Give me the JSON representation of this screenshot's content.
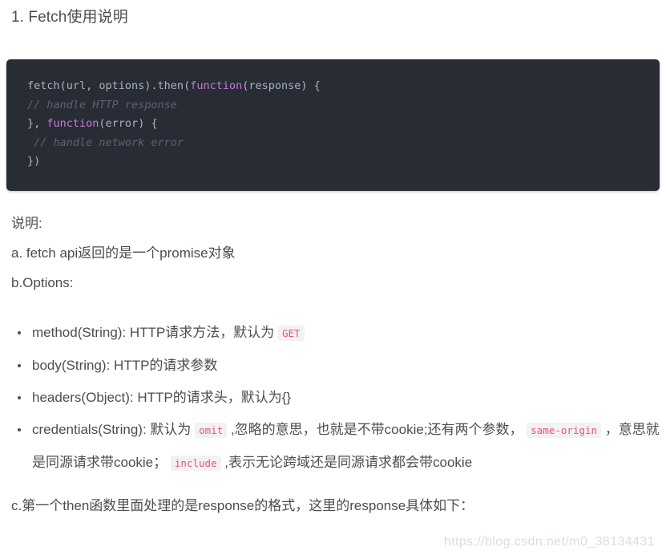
{
  "document": {
    "title": "1. Fetch使用说明",
    "background_color": "#ffffff",
    "text_color": "#4d4d4d"
  },
  "code_block": {
    "theme_background": "#282c34",
    "default_text_color": "#abb2bf",
    "keyword_color": "#c678dd",
    "comment_color": "#5c6370",
    "language": "javascript",
    "lines": [
      {
        "segments": [
          {
            "text": "fetch(url, options).then(",
            "type": "plain"
          },
          {
            "text": "function",
            "type": "keyword"
          },
          {
            "text": "(response) {",
            "type": "plain"
          }
        ]
      },
      {
        "segments": [
          {
            "text": "// handle HTTP response",
            "type": "comment"
          }
        ]
      },
      {
        "segments": [
          {
            "text": "}, ",
            "type": "plain"
          },
          {
            "text": "function",
            "type": "keyword"
          },
          {
            "text": "(error) {",
            "type": "plain"
          }
        ]
      },
      {
        "segments": [
          {
            "text": " // handle network error",
            "type": "comment"
          }
        ]
      },
      {
        "segments": [
          {
            "text": "})",
            "type": "plain"
          }
        ]
      }
    ]
  },
  "prose": {
    "note_label": "说明:",
    "item_a": "a. fetch api返回的是一个promise对象",
    "item_b": "b.Options:"
  },
  "options_list": {
    "items": [
      {
        "parts": [
          {
            "text": "method(String): HTTP请求方法，默认为 ",
            "type": "text"
          },
          {
            "text": "GET",
            "type": "code"
          }
        ]
      },
      {
        "parts": [
          {
            "text": "body(String): HTTP的请求参数",
            "type": "text"
          }
        ]
      },
      {
        "parts": [
          {
            "text": "headers(Object): HTTP的请求头，默认为{}",
            "type": "text"
          }
        ]
      },
      {
        "parts": [
          {
            "text": "credentials(String): 默认为 ",
            "type": "text"
          },
          {
            "text": "omit",
            "type": "code"
          },
          {
            "text": " ,忽略的意思，也就是不带cookie;还有两个参数， ",
            "type": "text"
          },
          {
            "text": "same-origin",
            "type": "code"
          },
          {
            "text": " ，意思就是同源请求带cookie；  ",
            "type": "text"
          },
          {
            "text": "include",
            "type": "code"
          },
          {
            "text": " ,表示无论跨域还是同源请求都会带cookie",
            "type": "text"
          }
        ]
      }
    ]
  },
  "trailing": {
    "item_c": "c.第一个then函数里面处理的是response的格式，这里的response具体如下："
  },
  "watermark": {
    "text": "https://blog.csdn.net/m0_38134431",
    "color": "#d9dde2"
  },
  "inline_code_style": {
    "text_color": "#e8527f",
    "background_color": "#f2f2f2"
  }
}
